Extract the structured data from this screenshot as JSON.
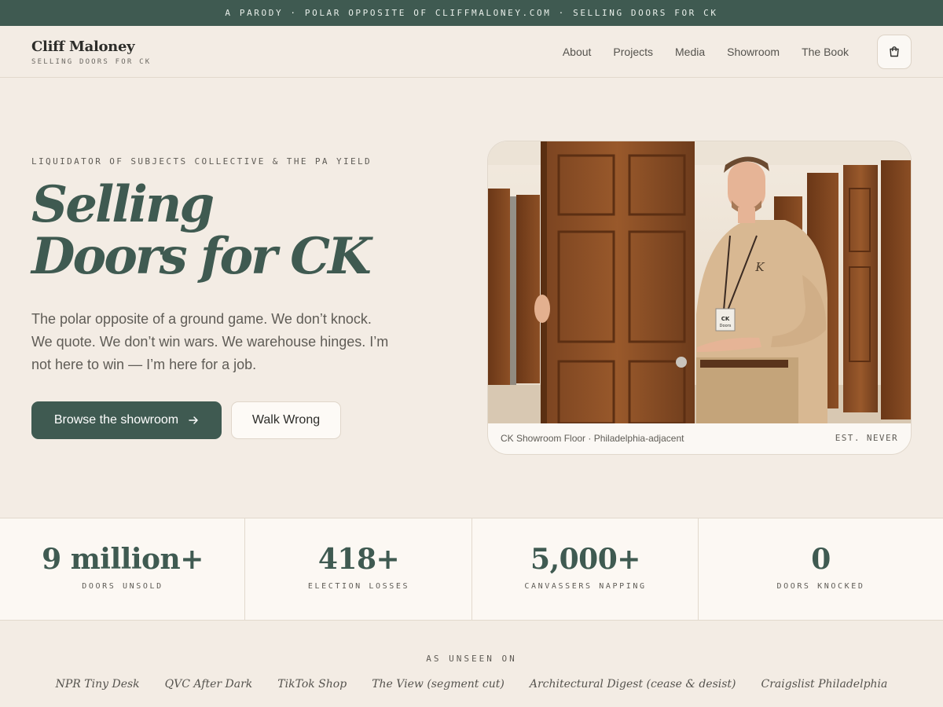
{
  "topbar": {
    "text": "A PARODY · POLAR OPPOSITE OF CLIFFMALONEY.COM · SELLING DOORS FOR CK"
  },
  "header": {
    "brand_name": "Cliff Maloney",
    "brand_tagline": "SELLING DOORS FOR CK",
    "nav": [
      "About",
      "Projects",
      "Media",
      "Showroom",
      "The Book"
    ],
    "cart_icon": "shopping-bag-icon"
  },
  "hero": {
    "eyebrow": "LIQUIDATOR OF SUBJECTS COLLECTIVE & THE PA YIELD",
    "headline_line1": "Selling",
    "headline_line2": "Doors for CK",
    "subtext": "The polar opposite of a ground game. We don’t knock. We quote. We don’t win wars. We warehouse hinges. I’m not here to win — I’m here for a job.",
    "primary_button": "Browse the showroom",
    "primary_button_icon": "arrow-right-icon",
    "secondary_button": "Walk Wrong",
    "photo_caption": "CK Showroom Floor · Philadelphia-adjacent",
    "photo_badge": "EST. NEVER",
    "photo_name_tag": "CK Doors",
    "shirt_logo": "K"
  },
  "stats": [
    {
      "value": "9 million+",
      "label": "DOORS UNSOLD"
    },
    {
      "value": "418+",
      "label": "ELECTION LOSSES"
    },
    {
      "value": "5,000+",
      "label": "CANVASSERS NAPPING"
    },
    {
      "value": "0",
      "label": "DOORS KNOCKED"
    }
  ],
  "press": {
    "label": "AS UNSEEN ON",
    "outlets": [
      "NPR Tiny Desk",
      "QVC After Dark",
      "TikTok Shop",
      "The View (segment cut)",
      "Architectural Digest (cease & desist)",
      "Craigslist Philadelphia"
    ]
  },
  "colors": {
    "accent": "#3f5a51",
    "background": "#f3ece4",
    "surface": "#fcf8f3"
  }
}
